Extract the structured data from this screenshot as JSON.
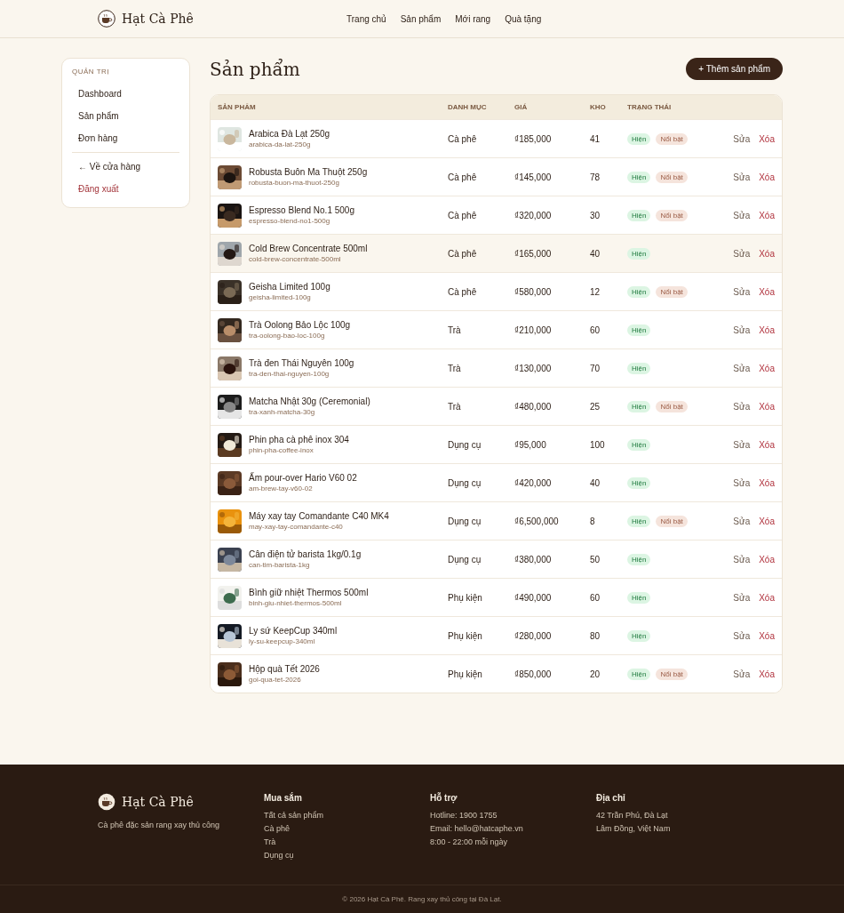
{
  "header": {
    "brand": "Hạt Cà Phê",
    "nav": [
      {
        "label": "Trang chủ"
      },
      {
        "label": "Sản phẩm"
      },
      {
        "label": "Mới rang"
      },
      {
        "label": "Quà tặng"
      }
    ]
  },
  "sidebar": {
    "heading": "QUẢN TRỊ",
    "items": [
      {
        "label": "Dashboard",
        "kind": "link"
      },
      {
        "label": "Sản phẩm",
        "kind": "link"
      },
      {
        "label": "Đơn hàng",
        "kind": "link"
      },
      {
        "label": "← Về cửa hàng",
        "kind": "back"
      },
      {
        "label": "Đăng xuất",
        "kind": "danger"
      }
    ]
  },
  "page": {
    "title": "Sản phẩm",
    "add_button": "+ Thêm sản phẩm"
  },
  "table": {
    "columns": [
      "SẢN PHẨM",
      "DANH MỤC",
      "GIÁ",
      "KHO",
      "TRẠNG THÁI"
    ],
    "rows": [
      {
        "name": "Arabica Đà Lạt 250g",
        "slug": "arabica-da-lat-250g",
        "category": "Cà phê",
        "price": "₫185,000",
        "stock": "41",
        "visible": "Hiện",
        "featured": "Nổi bật",
        "selected": false,
        "edit": "Sửa",
        "delete": "Xóa"
      },
      {
        "name": "Robusta Buôn Ma Thuột 250g",
        "slug": "robusta-buon-ma-thuot-250g",
        "category": "Cà phê",
        "price": "₫145,000",
        "stock": "78",
        "visible": "Hiện",
        "featured": "Nổi bật",
        "selected": false,
        "edit": "Sửa",
        "delete": "Xóa"
      },
      {
        "name": "Espresso Blend No.1 500g",
        "slug": "espresso-blend-no1-500g",
        "category": "Cà phê",
        "price": "₫320,000",
        "stock": "30",
        "visible": "Hiện",
        "featured": "Nổi bật",
        "selected": false,
        "edit": "Sửa",
        "delete": "Xóa"
      },
      {
        "name": "Cold Brew Concentrate 500ml",
        "slug": "cold-brew-concentrate-500ml",
        "category": "Cà phê",
        "price": "₫165,000",
        "stock": "40",
        "visible": "Hiện",
        "selected": true,
        "edit": "Sửa",
        "delete": "Xóa"
      },
      {
        "name": "Geisha Limited 100g",
        "slug": "geisha-limited-100g",
        "category": "Cà phê",
        "price": "₫580,000",
        "stock": "12",
        "visible": "Hiện",
        "featured": "Nổi bật",
        "selected": false,
        "edit": "Sửa",
        "delete": "Xóa"
      },
      {
        "name": "Trà Oolong Bảo Lộc 100g",
        "slug": "tra-oolong-bao-loc-100g",
        "category": "Trà",
        "price": "₫210,000",
        "stock": "60",
        "visible": "Hiện",
        "selected": false,
        "edit": "Sửa",
        "delete": "Xóa"
      },
      {
        "name": "Trà đen Thái Nguyên 100g",
        "slug": "tra-den-thai-nguyen-100g",
        "category": "Trà",
        "price": "₫130,000",
        "stock": "70",
        "visible": "Hiện",
        "selected": false,
        "edit": "Sửa",
        "delete": "Xóa"
      },
      {
        "name": "Matcha Nhật 30g (Ceremonial)",
        "slug": "tra-xanh-matcha-30g",
        "category": "Trà",
        "price": "₫480,000",
        "stock": "25",
        "visible": "Hiện",
        "featured": "Nổi bật",
        "selected": false,
        "edit": "Sửa",
        "delete": "Xóa"
      },
      {
        "name": "Phin pha cà phê inox 304",
        "slug": "phin-pha-coffee-inox",
        "category": "Dụng cụ",
        "price": "₫95,000",
        "stock": "100",
        "visible": "Hiện",
        "selected": false,
        "edit": "Sửa",
        "delete": "Xóa"
      },
      {
        "name": "Ấm pour-over Hario V60 02",
        "slug": "am-brew-tay-v60-02",
        "category": "Dụng cụ",
        "price": "₫420,000",
        "stock": "40",
        "visible": "Hiện",
        "selected": false,
        "edit": "Sửa",
        "delete": "Xóa"
      },
      {
        "name": "Máy xay tay Comandante C40 MK4",
        "slug": "may-xay-tay-comandante-c40",
        "category": "Dụng cụ",
        "price": "₫6,500,000",
        "stock": "8",
        "visible": "Hiện",
        "featured": "Nổi bật",
        "selected": false,
        "edit": "Sửa",
        "delete": "Xóa"
      },
      {
        "name": "Cân điện tử barista 1kg/0.1g",
        "slug": "can-tim-barista-1kg",
        "category": "Dụng cụ",
        "price": "₫380,000",
        "stock": "50",
        "visible": "Hiện",
        "selected": false,
        "edit": "Sửa",
        "delete": "Xóa"
      },
      {
        "name": "Bình giữ nhiệt Thermos 500ml",
        "slug": "binh-giu-nhiet-thermos-500ml",
        "category": "Phụ kiện",
        "price": "₫490,000",
        "stock": "60",
        "visible": "Hiện",
        "selected": false,
        "edit": "Sửa",
        "delete": "Xóa"
      },
      {
        "name": "Ly sứ KeepCup 340ml",
        "slug": "ly-su-keepcup-340ml",
        "category": "Phụ kiện",
        "price": "₫280,000",
        "stock": "80",
        "visible": "Hiện",
        "selected": false,
        "edit": "Sửa",
        "delete": "Xóa"
      },
      {
        "name": "Hộp quà Tết 2026",
        "slug": "goi-qua-tet-2026",
        "category": "Phụ kiện",
        "price": "₫850,000",
        "stock": "20",
        "visible": "Hiện",
        "featured": "Nổi bật",
        "selected": false,
        "edit": "Sửa",
        "delete": "Xóa"
      }
    ]
  },
  "footer": {
    "brand": "Hạt Cà Phê",
    "tagline": "Cà phê đặc sản rang xay thủ công",
    "columns": [
      {
        "heading": "Mua sắm",
        "lines": [
          "Tất cả sản phẩm",
          "Cà phê",
          "Trà",
          "Dụng cụ"
        ]
      },
      {
        "heading": "Hỗ trợ",
        "lines": [
          "Hotline: 1900 1755",
          "Email: hello@hatcaphe.vn",
          "8:00 - 22:00 mỗi ngày"
        ]
      },
      {
        "heading": "Địa chỉ",
        "lines": [
          "42 Trần Phú, Đà Lạt",
          "Lâm Đồng, Việt Nam"
        ]
      }
    ],
    "copyright": "© 2026 Hạt Cà Phê. Rang xay thủ công tại Đà Lạt."
  }
}
